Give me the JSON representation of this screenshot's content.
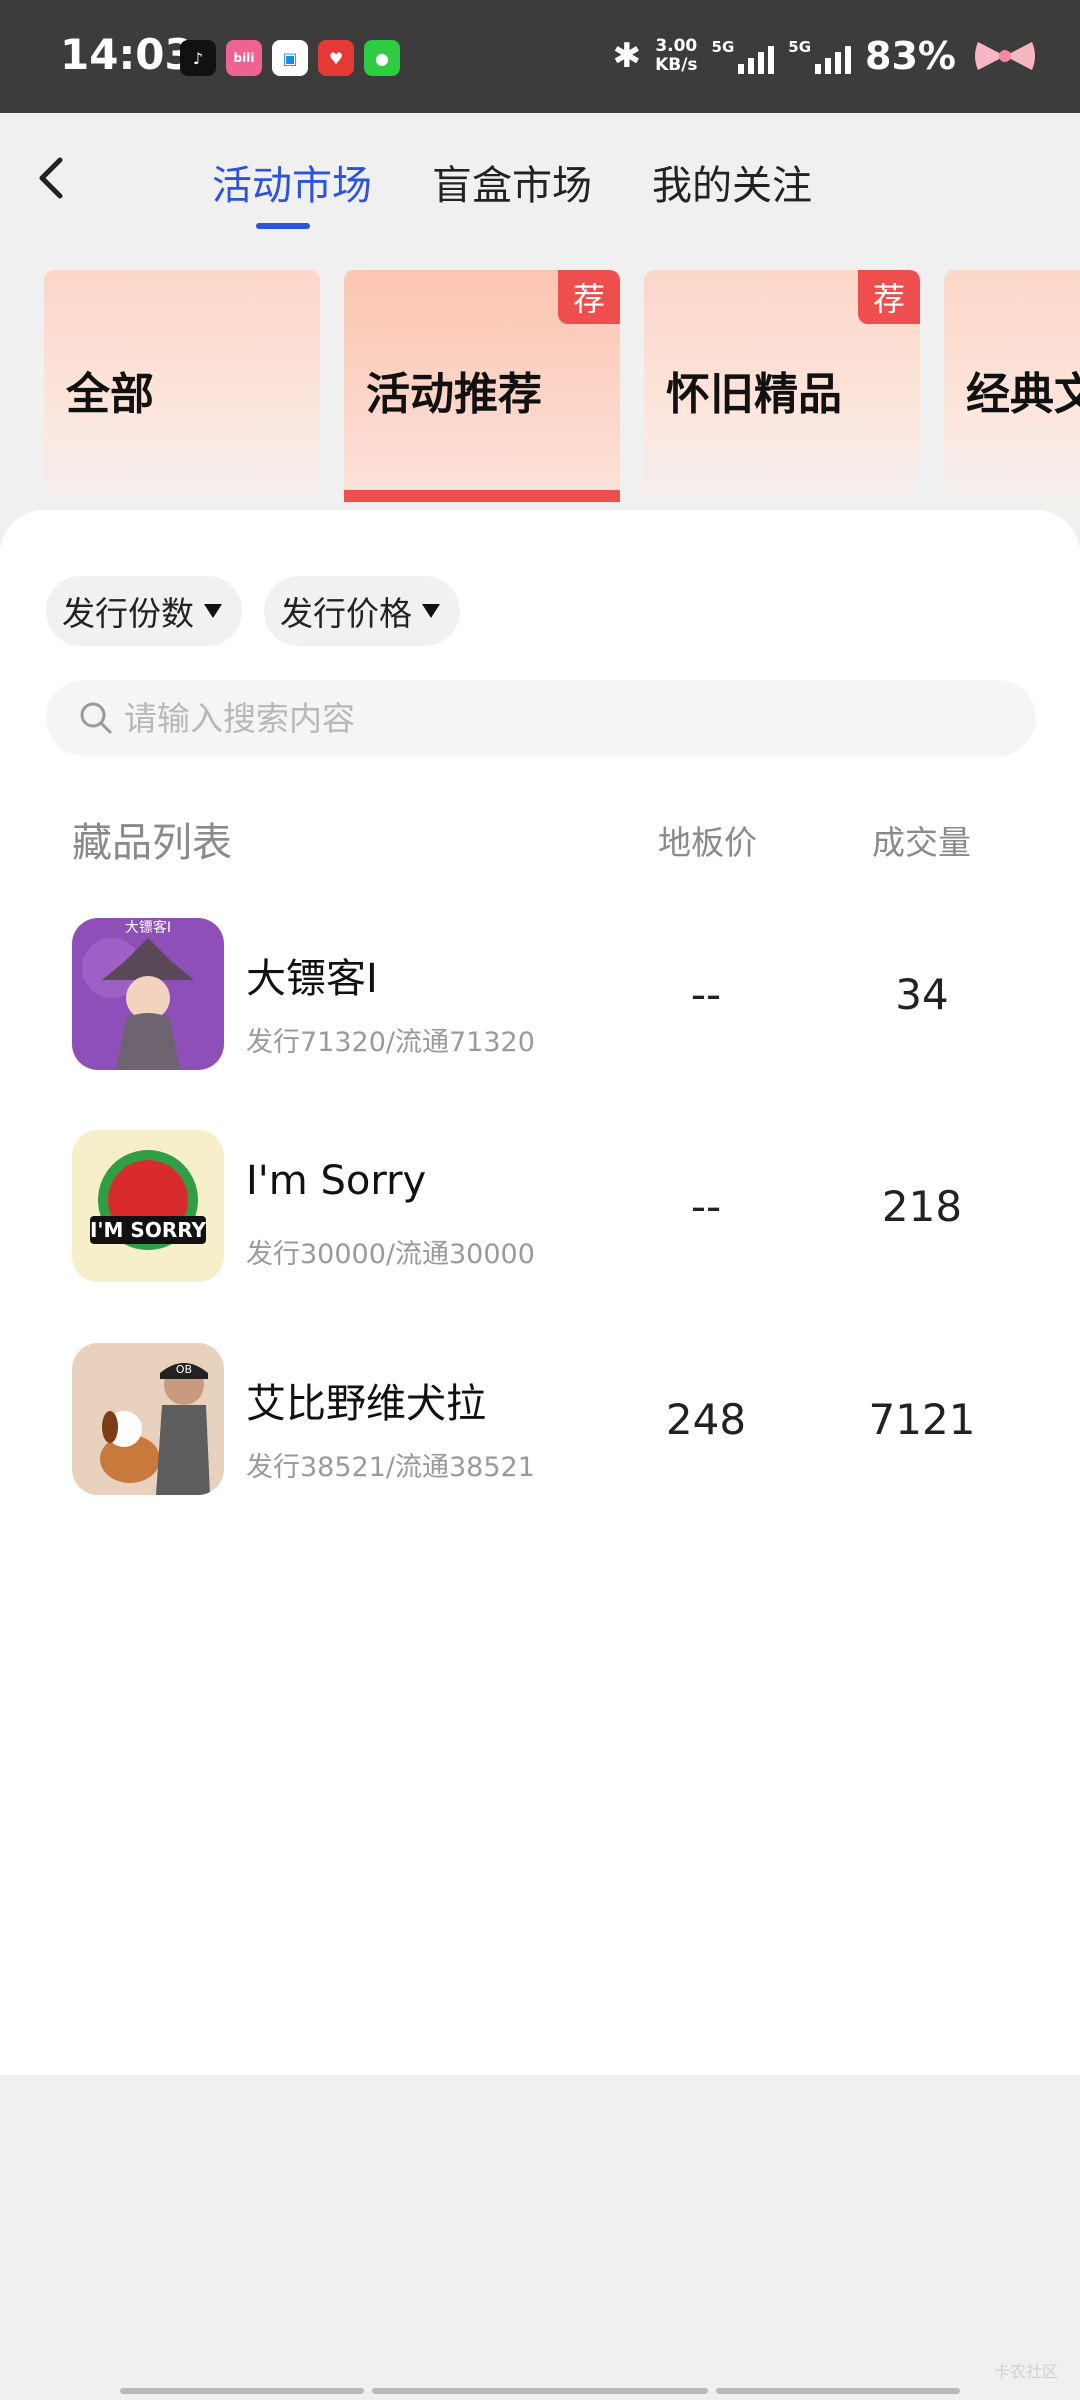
{
  "status_bar": {
    "time": "14:03",
    "app_icons": [
      {
        "name": "tiktok-icon",
        "glyph": "♪",
        "color": "#111111"
      },
      {
        "name": "bilibili-icon",
        "glyph": "bili",
        "color": "#f06292"
      },
      {
        "name": "app-blue-icon",
        "glyph": "▣",
        "color": "#1e88e5"
      },
      {
        "name": "app-red-icon",
        "glyph": "♥",
        "color": "#e53935"
      },
      {
        "name": "wechat-icon",
        "glyph": "●",
        "color": "#2ecc40"
      }
    ],
    "speed_value": "3.00",
    "speed_unit": "KB/s",
    "net1": "5G",
    "net2": "5G",
    "battery": "83%"
  },
  "header": {
    "tabs": [
      {
        "label": "活动市场",
        "active": true
      },
      {
        "label": "盲盒市场",
        "active": false
      },
      {
        "label": "我的关注",
        "active": false
      }
    ]
  },
  "categories": [
    {
      "label": "全部",
      "badge": ""
    },
    {
      "label": "活动推荐",
      "badge": "荐",
      "selected": true
    },
    {
      "label": "怀旧精品",
      "badge": "荐"
    },
    {
      "label": "经典文",
      "badge": ""
    }
  ],
  "filters": [
    {
      "label": "发行份数"
    },
    {
      "label": "发行价格"
    }
  ],
  "search": {
    "placeholder": "请输入搜索内容",
    "value": ""
  },
  "table": {
    "header_list": "藏品列表",
    "header_floor": "地板价",
    "header_volume": "成交量",
    "rows": [
      {
        "name": "大镖客I",
        "issue": "发行71320/流通71320",
        "floor": "--",
        "volume": "34",
        "thumb_text": "大镖客I"
      },
      {
        "name": "I'm Sorry",
        "issue": "发行30000/流通30000",
        "floor": "--",
        "volume": "218",
        "thumb_text": "I'M SORRY"
      },
      {
        "name": "艾比野维犬拉",
        "issue": "发行38521/流通38521",
        "floor": "248",
        "volume": "7121",
        "thumb_text": "OB"
      }
    ]
  },
  "watermark": "卡农社区",
  "colors": {
    "accent": "#2d54d8",
    "badge_red": "#ef4e4e",
    "status_bar_bg": "#3c3c3c"
  }
}
